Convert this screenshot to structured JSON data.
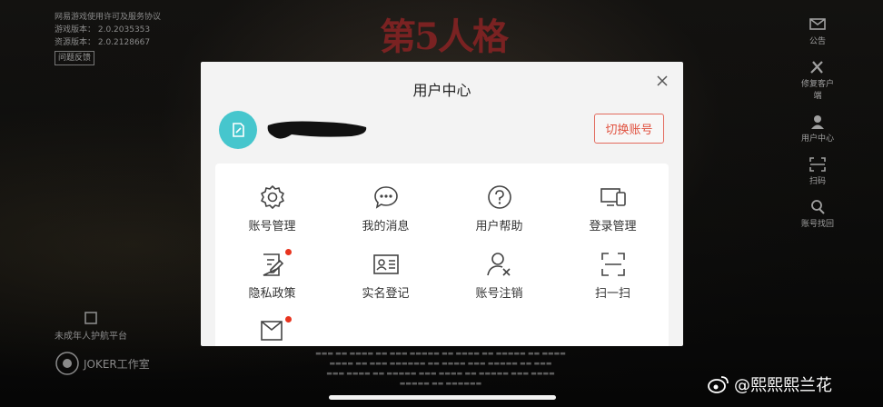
{
  "background": {
    "top_left": {
      "line1": "网易游戏使用许可及服务协议",
      "line2": "游戏版本： 2.0.2035353",
      "line3": "资源版本： 2.0.2128667",
      "feedback": "问题反馈"
    },
    "right_menu": [
      {
        "label": "公告",
        "icon": "announcement-icon"
      },
      {
        "label": "修复客户端",
        "icon": "repair-tools-icon"
      },
      {
        "label": "用户中心",
        "icon": "user-center-icon"
      },
      {
        "label": "扫码",
        "icon": "scan-icon"
      },
      {
        "label": "账号找回",
        "icon": "account-recovery-icon"
      }
    ],
    "bottom_left": {
      "minor_platform": "未成年人护航平台",
      "studio": "JOKER工作室"
    }
  },
  "modal": {
    "title": "用户中心",
    "switch_account": "切换账号",
    "items": [
      {
        "label": "账号管理",
        "icon": "gear-icon"
      },
      {
        "label": "我的消息",
        "icon": "chat-bubble-icon"
      },
      {
        "label": "用户帮助",
        "icon": "help-icon"
      },
      {
        "label": "登录管理",
        "icon": "devices-icon"
      },
      {
        "label": "隐私政策",
        "icon": "privacy-doc-icon",
        "badge": true
      },
      {
        "label": "实名登记",
        "icon": "id-card-icon"
      },
      {
        "label": "账号注销",
        "icon": "user-remove-icon"
      },
      {
        "label": "扫一扫",
        "icon": "scan-icon"
      }
    ],
    "partial_item": {
      "icon": "mail-check-icon",
      "badge": true
    }
  },
  "watermark": "@熙熙熙兰花",
  "colors": {
    "accent_red": "#e0513f",
    "avatar_teal": "#46c6cd",
    "badge_red": "#e8341f"
  }
}
